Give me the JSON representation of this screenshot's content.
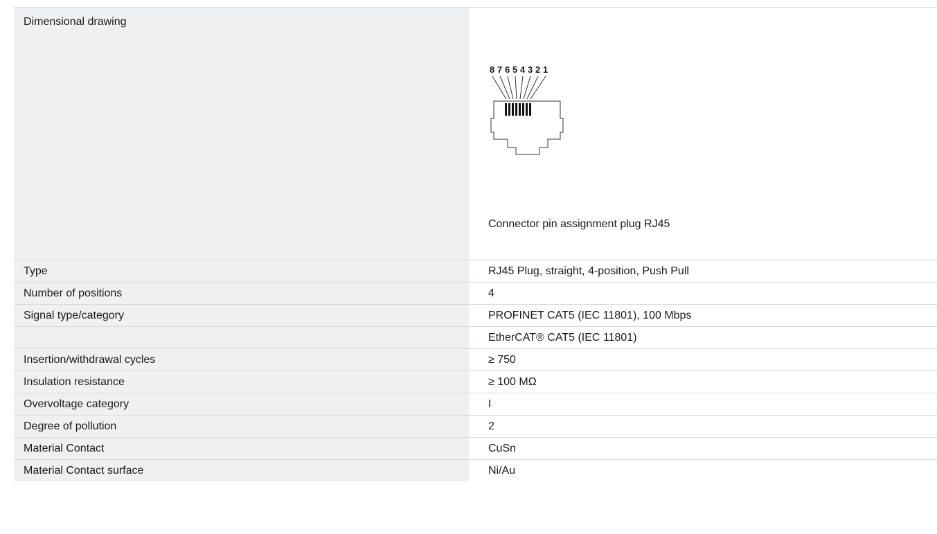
{
  "drawing": {
    "label": "Dimensional drawing",
    "caption": "Connector pin assignment plug RJ45",
    "pins": [
      "8",
      "7",
      "6",
      "5",
      "4",
      "3",
      "2",
      "1"
    ]
  },
  "specs": [
    {
      "label": "Type",
      "value": "RJ45 Plug, straight, 4-position, Push Pull"
    },
    {
      "label": "Number of positions",
      "value": "4"
    },
    {
      "label": "Signal type/category",
      "value": "PROFINET CAT5 (IEC 11801), 100 Mbps"
    },
    {
      "label": "",
      "value": "EtherCAT® CAT5 (IEC 11801)"
    },
    {
      "label": "Insertion/withdrawal cycles",
      "value": "≥ 750"
    },
    {
      "label": "Insulation resistance",
      "value": "≥ 100 MΩ"
    },
    {
      "label": "Overvoltage category",
      "value": "I"
    },
    {
      "label": "Degree of pollution",
      "value": "2"
    },
    {
      "label": "Material Contact",
      "value": "CuSn"
    },
    {
      "label": "Material Contact surface",
      "value": "Ni/Au"
    }
  ]
}
